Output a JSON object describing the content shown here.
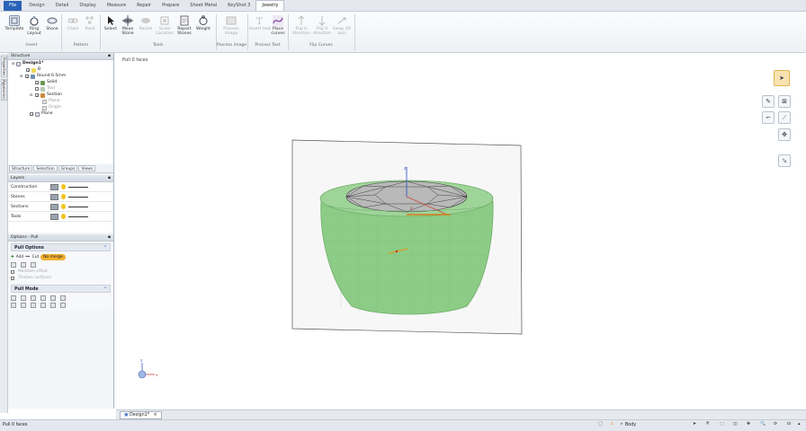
{
  "menu": {
    "file": "File",
    "tabs": [
      "Design",
      "Detail",
      "Display",
      "Measure",
      "Repair",
      "Prepare",
      "Sheet Metal",
      "KeyShot 3"
    ],
    "active": "Jewelry"
  },
  "ribbon": {
    "buttons": [
      {
        "label": "Template",
        "icon": "template-icon",
        "enabled": true
      },
      {
        "label": "Ring Layout",
        "icon": "ring-layout-icon",
        "enabled": true
      },
      {
        "label": "Stone",
        "icon": "stone-icon",
        "enabled": true
      },
      {
        "label": "Chain",
        "icon": "chain-icon",
        "enabled": false
      },
      {
        "label": "Pavé",
        "icon": "pave-icon",
        "enabled": false
      },
      {
        "label": "Select",
        "icon": "select-arrow-icon",
        "enabled": true
      },
      {
        "label": "Move Stone",
        "icon": "move-stone-icon",
        "enabled": true
      },
      {
        "label": "Resize",
        "icon": "resize-icon",
        "enabled": false
      },
      {
        "label": "Scale Location",
        "icon": "scale-location-icon",
        "enabled": false
      },
      {
        "label": "Report Stones",
        "icon": "report-stones-icon",
        "enabled": true
      },
      {
        "label": "Weight",
        "icon": "weight-icon",
        "enabled": true
      },
      {
        "label": "Process image",
        "icon": "process-image-icon",
        "enabled": false
      },
      {
        "label": "Insert text",
        "icon": "insert-text-icon",
        "enabled": false
      },
      {
        "label": "Place curves",
        "icon": "place-curves-icon",
        "enabled": true
      },
      {
        "label": "Flip U direction",
        "icon": "flip-u-icon",
        "enabled": false
      },
      {
        "label": "Flip V direction",
        "icon": "flip-v-icon",
        "enabled": false
      },
      {
        "label": "Swap UV axis",
        "icon": "swap-uv-icon",
        "enabled": false
      }
    ],
    "groups": [
      "Insert",
      "Pattern",
      "Tools",
      "Process image",
      "Process Text",
      "Flip Curves"
    ]
  },
  "side_tabs": [
    "Properties",
    "Appearance"
  ],
  "structure": {
    "title": "Structure",
    "items": [
      {
        "label": "Design1*",
        "icon": "design-icon"
      },
      {
        "label": "B",
        "icon": "component-icon"
      },
      {
        "label": "Round 6.5mm",
        "icon": "round-stone-icon"
      },
      {
        "label": "Solid",
        "icon": "solid-icon"
      },
      {
        "label": "Tool",
        "icon": "tool-icon"
      },
      {
        "label": "Section",
        "icon": "section-icon"
      },
      {
        "label": "Plane",
        "icon": "plane-icon"
      },
      {
        "label": "Origin",
        "icon": "origin-icon"
      },
      {
        "label": "Plane",
        "icon": "plane-icon"
      }
    ],
    "tabs": [
      "Structure",
      "Selection",
      "Groups",
      "Views"
    ]
  },
  "layers": {
    "title": "Layers",
    "rows": [
      "Construction",
      "Stones",
      "Sections",
      "Tools"
    ]
  },
  "options": {
    "title": "Options - Pull",
    "pull_options": {
      "title": "Pull Options",
      "add": "Add",
      "cut": "Cut",
      "no_merge": "No merge",
      "maintain_offset": "Maintain offset",
      "thicken_surfaces": "Thicken surfaces"
    },
    "pull_mode": {
      "title": "Pull Mode"
    }
  },
  "viewport": {
    "hint": "Pull 0 faces",
    "axis_labels": {
      "z": "z",
      "y": "y",
      "x": "x"
    }
  },
  "doc_tab": {
    "label": "Design1*",
    "close": "×"
  },
  "status": {
    "left": "Pull 0 faces",
    "selection": "Body"
  },
  "colors": {
    "accent": "#2a63b8",
    "model_green": "#8ccc86",
    "highlight_orange": "#f0b030",
    "active_tool": "#f3c04a"
  }
}
